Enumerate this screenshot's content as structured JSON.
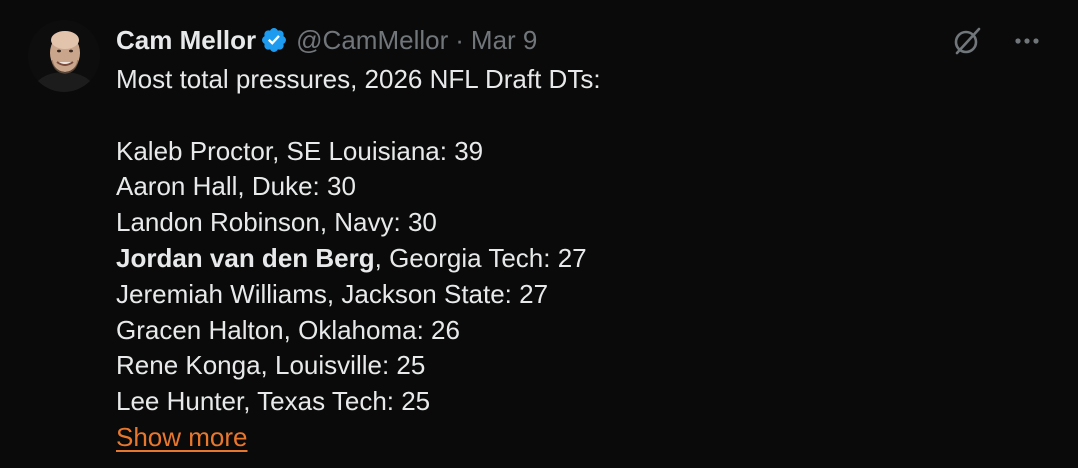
{
  "author": {
    "name": "Cam Mellor",
    "handle": "@CamMellor",
    "separator": "·",
    "date": "Mar 9",
    "verified": true
  },
  "icons": {
    "grok": "grok-slash-icon",
    "more": "more-options-icon"
  },
  "tweet": {
    "intro": "Most total pressures, 2026 NFL Draft DTs:",
    "lines": [
      {
        "bold": "",
        "text": "Kaleb Proctor, SE Louisiana: 39"
      },
      {
        "bold": "",
        "text": "Aaron Hall, Duke: 30"
      },
      {
        "bold": "",
        "text": "Landon Robinson, Navy: 30"
      },
      {
        "bold": "Jordan van den Berg",
        "text": ", Georgia Tech: 27"
      },
      {
        "bold": "",
        "text": "Jeremiah Williams, Jackson State: 27"
      },
      {
        "bold": "",
        "text": "Gracen Halton, Oklahoma: 26"
      },
      {
        "bold": "",
        "text": "Rene Konga, Louisville: 25"
      },
      {
        "bold": "",
        "text": "Lee Hunter, Texas Tech: 25"
      }
    ],
    "show_more": "Show more"
  },
  "colors": {
    "background": "#0a0a0a",
    "text": "#e7e9ea",
    "muted": "#71767b",
    "verified": "#1d9bf0",
    "link": "#e8772e"
  }
}
